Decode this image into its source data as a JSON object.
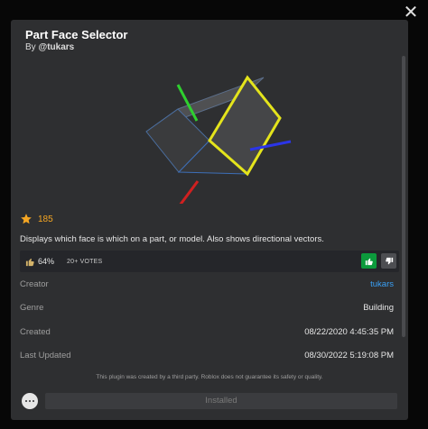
{
  "window": {
    "close_icon": "close-icon"
  },
  "plugin": {
    "title": "Part Face Selector",
    "byline_prefix": "By ",
    "author_handle": "@tukars"
  },
  "rating": {
    "value": "185",
    "icon": "star-icon",
    "color": "#f5a623"
  },
  "description": "Displays which face is which on a part, or model. Also shows directional vectors.",
  "votes": {
    "percent": "64%",
    "count": "20+ VOTES",
    "up_icon": "thumbs-up-icon",
    "down_icon": "thumbs-down-icon",
    "up_color": "#0c9a3c"
  },
  "details": {
    "creator_label": "Creator",
    "creator_value": "tukars",
    "genre_label": "Genre",
    "genre_value": "Building",
    "created_label": "Created",
    "created_value": "08/22/2020 4:45:35 PM",
    "updated_label": "Last Updated",
    "updated_value": "08/30/2022 5:19:08 PM"
  },
  "disclaimer": "This plugin was created by a third party. Roblox does not guarantee its safety or quality.",
  "actions": {
    "chat_icon": "chat-bubble-icon",
    "install_label": "Installed"
  }
}
